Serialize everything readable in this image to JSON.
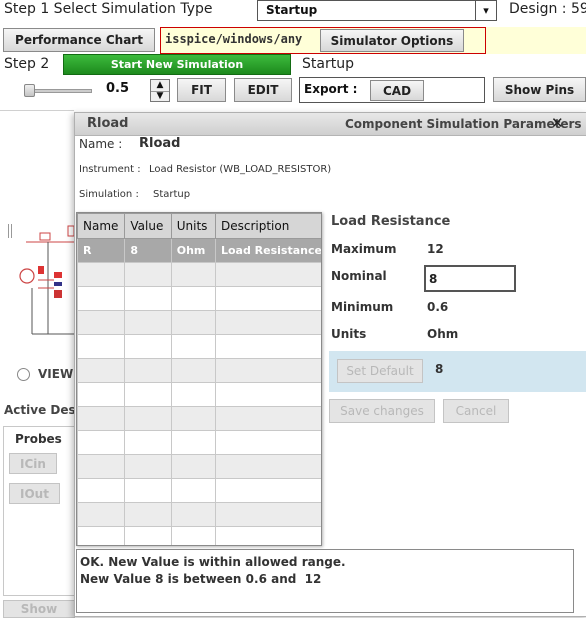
{
  "header": {
    "step1_label": "Step 1 Select Simulation Type",
    "sim_type_selected": "Startup",
    "design_label": "Design : 59",
    "performance_chart": "Performance Chart",
    "sim_path": "isspice/windows/any",
    "simulator_options": "Simulator Options",
    "step2_label": "Step 2",
    "start_new_sim": "Start New Simulation",
    "step2_status": "Startup",
    "zoom_value": "0.5",
    "fit": "FIT",
    "edit": "EDIT",
    "export_label": "Export :",
    "cad": "CAD",
    "show_pins": "Show Pins"
  },
  "background": {
    "view_label": "VIEW",
    "active_des": "Active Des",
    "probes_tab": "Probes",
    "probe_buttons": [
      "ICin",
      "IOut"
    ],
    "show_button": "Show"
  },
  "dialog": {
    "component": "Rload",
    "title": "Component Simulation Parameters",
    "close": "✕",
    "name_label": "Name :",
    "name_value": "Rload",
    "instrument_label": "Instrument :",
    "instrument_value": "Load Resistor (WB_LOAD_RESISTOR)",
    "simulation_label": "Simulation :",
    "simulation_value": "Startup",
    "table": {
      "headers": [
        "Name",
        "Value",
        "Units",
        "Description"
      ],
      "rows": [
        [
          "R",
          "8",
          "Ohm",
          "Load Resistance"
        ]
      ]
    },
    "detail": {
      "title": "Load Resistance",
      "maximum_label": "Maximum",
      "maximum_value": "12",
      "nominal_label": "Nominal",
      "nominal_value": "8",
      "minimum_label": "Minimum",
      "minimum_value": "0.6",
      "units_label": "Units",
      "units_value": "Ohm",
      "set_default": "Set Default",
      "default_value": "8",
      "save_changes": "Save changes",
      "cancel": "Cancel"
    },
    "status_line1": "OK. New Value is within allowed range.",
    "status_line2": "New Value 8 is between 0.6 and  12"
  }
}
